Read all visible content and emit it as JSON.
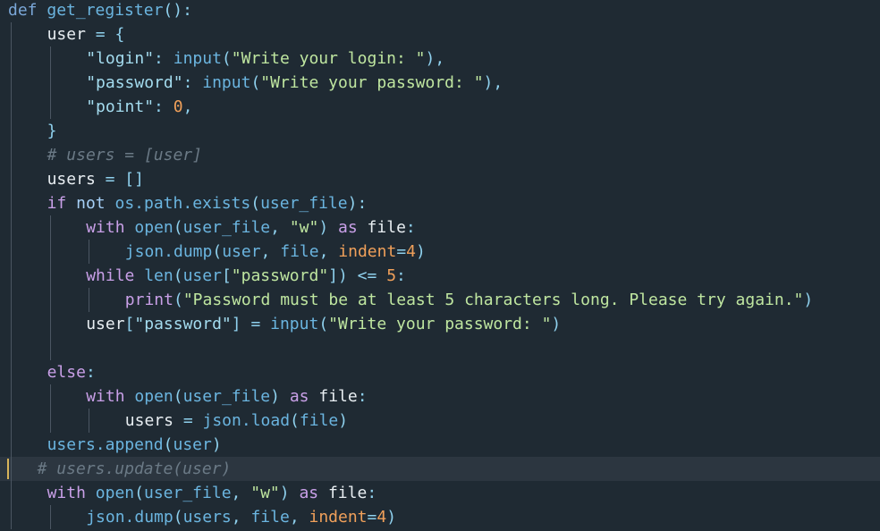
{
  "editor": {
    "lines": [
      {
        "indent": 0,
        "tokens": [
          {
            "t": "def",
            "c": "def"
          },
          {
            "t": " ",
            "c": "var"
          },
          {
            "t": "get_register",
            "c": "fn"
          },
          {
            "t": "():",
            "c": "punc"
          }
        ]
      },
      {
        "indent": 1,
        "tokens": [
          {
            "t": "user",
            "c": "var"
          },
          {
            "t": " = ",
            "c": "op"
          },
          {
            "t": "{",
            "c": "punc"
          }
        ]
      },
      {
        "indent": 2,
        "tokens": [
          {
            "t": "\"login\"",
            "c": "str"
          },
          {
            "t": ": ",
            "c": "punc"
          },
          {
            "t": "input",
            "c": "fn"
          },
          {
            "t": "(",
            "c": "punc"
          },
          {
            "t": "\"Write your login: \"",
            "c": "green"
          },
          {
            "t": "),",
            "c": "punc"
          }
        ]
      },
      {
        "indent": 2,
        "tokens": [
          {
            "t": "\"password\"",
            "c": "str"
          },
          {
            "t": ": ",
            "c": "punc"
          },
          {
            "t": "input",
            "c": "fn"
          },
          {
            "t": "(",
            "c": "punc"
          },
          {
            "t": "\"Write your password: \"",
            "c": "green"
          },
          {
            "t": "),",
            "c": "punc"
          }
        ]
      },
      {
        "indent": 2,
        "tokens": [
          {
            "t": "\"point\"",
            "c": "str"
          },
          {
            "t": ": ",
            "c": "punc"
          },
          {
            "t": "0",
            "c": "num"
          },
          {
            "t": ",",
            "c": "punc"
          }
        ]
      },
      {
        "indent": 1,
        "tokens": [
          {
            "t": "}",
            "c": "punc"
          }
        ]
      },
      {
        "indent": 1,
        "tokens": [
          {
            "t": "# users = [user]",
            "c": "cmt"
          }
        ]
      },
      {
        "indent": 1,
        "tokens": [
          {
            "t": "users",
            "c": "var"
          },
          {
            "t": " = ",
            "c": "op"
          },
          {
            "t": "[]",
            "c": "punc"
          }
        ]
      },
      {
        "indent": 1,
        "tokens": [
          {
            "t": "if",
            "c": "ctrl"
          },
          {
            "t": " ",
            "c": "var"
          },
          {
            "t": "not",
            "c": "kw"
          },
          {
            "t": " os.path.",
            "c": "fn"
          },
          {
            "t": "exists",
            "c": "fn"
          },
          {
            "t": "(",
            "c": "punc"
          },
          {
            "t": "user_file",
            "c": "fn"
          },
          {
            "t": "):",
            "c": "punc"
          }
        ]
      },
      {
        "indent": 2,
        "tokens": [
          {
            "t": "with",
            "c": "ctrl"
          },
          {
            "t": " ",
            "c": "var"
          },
          {
            "t": "open",
            "c": "fn"
          },
          {
            "t": "(",
            "c": "punc"
          },
          {
            "t": "user_file",
            "c": "fn"
          },
          {
            "t": ", ",
            "c": "punc"
          },
          {
            "t": "\"w\"",
            "c": "green"
          },
          {
            "t": ") ",
            "c": "punc"
          },
          {
            "t": "as",
            "c": "ctrl"
          },
          {
            "t": " file",
            "c": "var"
          },
          {
            "t": ":",
            "c": "punc"
          }
        ]
      },
      {
        "indent": 3,
        "tokens": [
          {
            "t": "json.",
            "c": "fn"
          },
          {
            "t": "dump",
            "c": "fn"
          },
          {
            "t": "(",
            "c": "punc"
          },
          {
            "t": "user",
            "c": "fn"
          },
          {
            "t": ", ",
            "c": "punc"
          },
          {
            "t": "file",
            "c": "fn"
          },
          {
            "t": ", ",
            "c": "punc"
          },
          {
            "t": "indent",
            "c": "param"
          },
          {
            "t": "=",
            "c": "op"
          },
          {
            "t": "4",
            "c": "num"
          },
          {
            "t": ")",
            "c": "punc"
          }
        ]
      },
      {
        "indent": 2,
        "tokens": [
          {
            "t": "while",
            "c": "ctrl"
          },
          {
            "t": " ",
            "c": "var"
          },
          {
            "t": "len",
            "c": "fn"
          },
          {
            "t": "(",
            "c": "punc"
          },
          {
            "t": "user",
            "c": "fn"
          },
          {
            "t": "[",
            "c": "punc"
          },
          {
            "t": "\"password\"",
            "c": "green"
          },
          {
            "t": "]) ",
            "c": "punc"
          },
          {
            "t": "<=",
            "c": "op"
          },
          {
            "t": " ",
            "c": "var"
          },
          {
            "t": "5",
            "c": "num"
          },
          {
            "t": ":",
            "c": "punc"
          }
        ]
      },
      {
        "indent": 3,
        "tokens": [
          {
            "t": "print",
            "c": "ctrl"
          },
          {
            "t": "(",
            "c": "punc"
          },
          {
            "t": "\"Password must be at least 5 characters long. Please try again.\"",
            "c": "green"
          },
          {
            "t": ")",
            "c": "punc"
          }
        ]
      },
      {
        "indent": 2,
        "tokens": [
          {
            "t": "user",
            "c": "var"
          },
          {
            "t": "[",
            "c": "punc"
          },
          {
            "t": "\"password\"",
            "c": "str"
          },
          {
            "t": "] = ",
            "c": "punc"
          },
          {
            "t": "input",
            "c": "fn"
          },
          {
            "t": "(",
            "c": "punc"
          },
          {
            "t": "\"Write your password: \"",
            "c": "green"
          },
          {
            "t": ")",
            "c": "punc"
          }
        ]
      },
      {
        "indent": 0,
        "tokens": []
      },
      {
        "indent": 1,
        "tokens": [
          {
            "t": "else",
            "c": "ctrl"
          },
          {
            "t": ":",
            "c": "punc"
          }
        ]
      },
      {
        "indent": 2,
        "tokens": [
          {
            "t": "with",
            "c": "ctrl"
          },
          {
            "t": " ",
            "c": "var"
          },
          {
            "t": "open",
            "c": "fn"
          },
          {
            "t": "(",
            "c": "punc"
          },
          {
            "t": "user_file",
            "c": "fn"
          },
          {
            "t": ") ",
            "c": "punc"
          },
          {
            "t": "as",
            "c": "ctrl"
          },
          {
            "t": " file",
            "c": "var"
          },
          {
            "t": ":",
            "c": "punc"
          }
        ]
      },
      {
        "indent": 3,
        "tokens": [
          {
            "t": "users",
            "c": "var"
          },
          {
            "t": " = ",
            "c": "op"
          },
          {
            "t": "json.",
            "c": "fn"
          },
          {
            "t": "load",
            "c": "fn"
          },
          {
            "t": "(",
            "c": "punc"
          },
          {
            "t": "file",
            "c": "fn"
          },
          {
            "t": ")",
            "c": "punc"
          }
        ]
      },
      {
        "indent": 1,
        "tokens": [
          {
            "t": "users.",
            "c": "fn"
          },
          {
            "t": "append",
            "c": "fn"
          },
          {
            "t": "(",
            "c": "punc"
          },
          {
            "t": "user",
            "c": "fn"
          },
          {
            "t": ")",
            "c": "punc"
          }
        ]
      },
      {
        "indent": 1,
        "current": true,
        "shift": -11,
        "tokens": [
          {
            "t": "# users.update(user)",
            "c": "cmt"
          }
        ]
      },
      {
        "indent": 1,
        "tokens": [
          {
            "t": "with",
            "c": "ctrl"
          },
          {
            "t": " ",
            "c": "var"
          },
          {
            "t": "open",
            "c": "fn"
          },
          {
            "t": "(",
            "c": "punc"
          },
          {
            "t": "user_file",
            "c": "fn"
          },
          {
            "t": ", ",
            "c": "punc"
          },
          {
            "t": "\"w\"",
            "c": "green"
          },
          {
            "t": ") ",
            "c": "punc"
          },
          {
            "t": "as",
            "c": "ctrl"
          },
          {
            "t": " file",
            "c": "var"
          },
          {
            "t": ":",
            "c": "punc"
          }
        ]
      },
      {
        "indent": 2,
        "tokens": [
          {
            "t": "json.",
            "c": "fn"
          },
          {
            "t": "dump",
            "c": "fn"
          },
          {
            "t": "(",
            "c": "punc"
          },
          {
            "t": "users",
            "c": "fn"
          },
          {
            "t": ", ",
            "c": "punc"
          },
          {
            "t": "file",
            "c": "fn"
          },
          {
            "t": ", ",
            "c": "punc"
          },
          {
            "t": "indent",
            "c": "param"
          },
          {
            "t": "=",
            "c": "op"
          },
          {
            "t": "4",
            "c": "num"
          },
          {
            "t": ")",
            "c": "punc"
          }
        ]
      }
    ]
  },
  "colors": {
    "background": "#1f2a33",
    "current_line": "#2c3640",
    "caret_marker": "#d7b45a",
    "indent_guide": "#4b5662"
  }
}
